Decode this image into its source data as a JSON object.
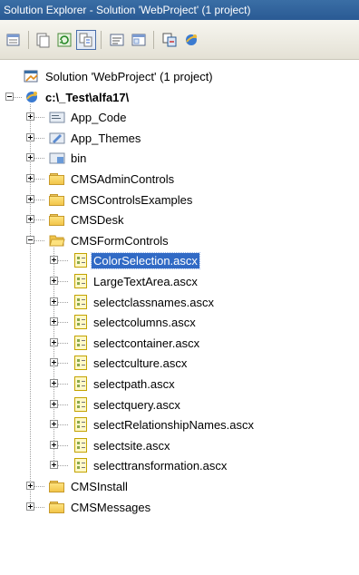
{
  "window": {
    "title": "Solution Explorer - Solution 'WebProject' (1 project)"
  },
  "toolbar": {
    "buttons": [
      {
        "icon": "properties-icon"
      },
      {
        "icon": "show-all-files-icon"
      },
      {
        "icon": "refresh-icon"
      },
      {
        "icon": "nest-related-files-icon",
        "pressed": true
      },
      {
        "icon": "view-code-icon"
      },
      {
        "icon": "view-designer-icon"
      },
      {
        "icon": "copy-website-icon"
      },
      {
        "icon": "asp-net-configuration-icon"
      }
    ]
  },
  "tree": {
    "solution": {
      "label": "Solution 'WebProject' (1 project)"
    },
    "project": {
      "label": "c:\\_Test\\alfa17\\"
    },
    "folders": [
      {
        "label": "App_Code",
        "icon": "app-code-folder-icon"
      },
      {
        "label": "App_Themes",
        "icon": "app-themes-folder-icon"
      },
      {
        "label": "bin",
        "icon": "bin-folder-icon"
      },
      {
        "label": "CMSAdminControls",
        "icon": "folder-icon"
      },
      {
        "label": "CMSControlsExamples",
        "icon": "folder-icon"
      },
      {
        "label": "CMSDesk",
        "icon": "folder-icon"
      },
      {
        "label": "CMSFormControls",
        "icon": "open-folder-icon",
        "expanded": true
      }
    ],
    "form_controls": [
      {
        "label": "ColorSelection.ascx",
        "selected": true
      },
      {
        "label": "LargeTextArea.ascx"
      },
      {
        "label": "selectclassnames.ascx"
      },
      {
        "label": "selectcolumns.ascx"
      },
      {
        "label": "selectcontainer.ascx"
      },
      {
        "label": "selectculture.ascx"
      },
      {
        "label": "selectpath.ascx"
      },
      {
        "label": "selectquery.ascx"
      },
      {
        "label": "selectRelationshipNames.ascx"
      },
      {
        "label": "selectsite.ascx"
      },
      {
        "label": "selecttransformation.ascx"
      }
    ],
    "folders_after": [
      {
        "label": "CMSInstall"
      },
      {
        "label": "CMSMessages"
      }
    ]
  }
}
